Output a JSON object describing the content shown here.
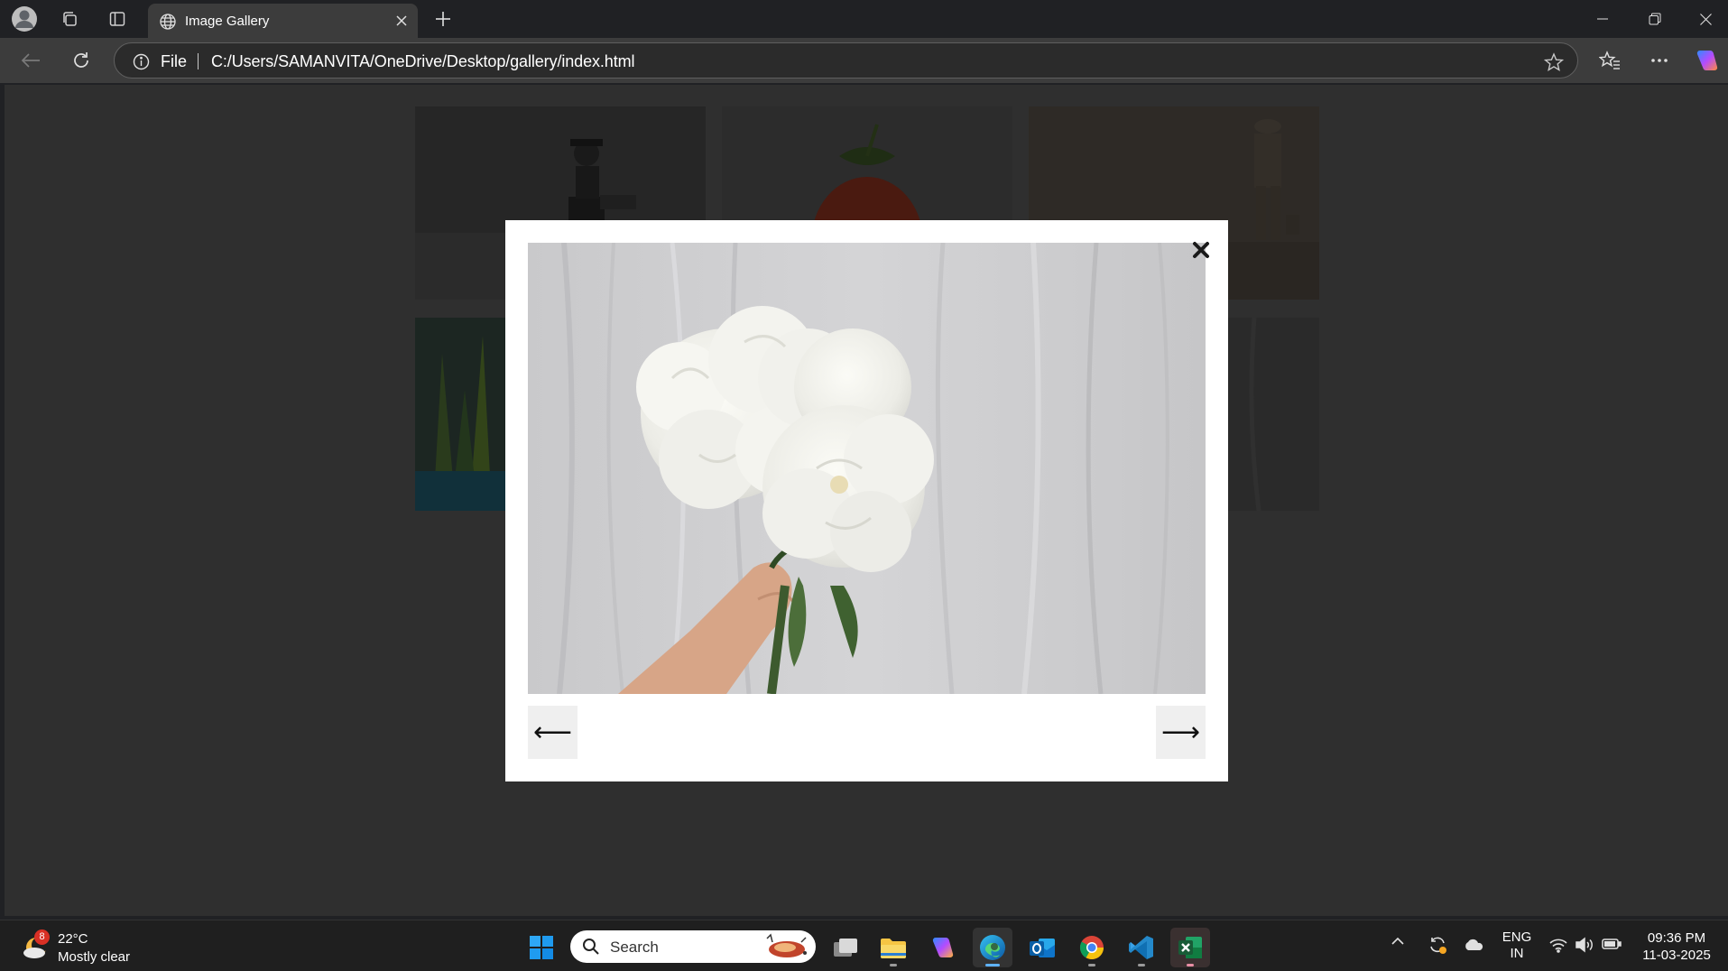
{
  "browser": {
    "tab_title": "Image Gallery",
    "address_scheme_label": "File",
    "url": "C:/Users/SAMANVITA/OneDrive/Desktop/gallery/index.html"
  },
  "lightbox": {
    "close_label": "✖",
    "prev_label": "⟵",
    "next_label": "⟶",
    "image_subject": "white-peony-bouquet"
  },
  "gallery": {
    "thumbnails": [
      "lego-figure",
      "strawberry",
      "toy-soldier",
      "green-plant",
      "grey-fabric"
    ]
  },
  "taskbar": {
    "weather_badge": "8",
    "weather_temp": "22°C",
    "weather_desc": "Mostly clear",
    "search_placeholder": "Search",
    "lang_top": "ENG",
    "lang_bottom": "IN",
    "time": "09:36 PM",
    "date": "11-03-2025"
  },
  "colors": {
    "accent_blue": "#0a84ff",
    "page_bg": "#2f2f2f",
    "modal_bg": "#ffffff"
  }
}
